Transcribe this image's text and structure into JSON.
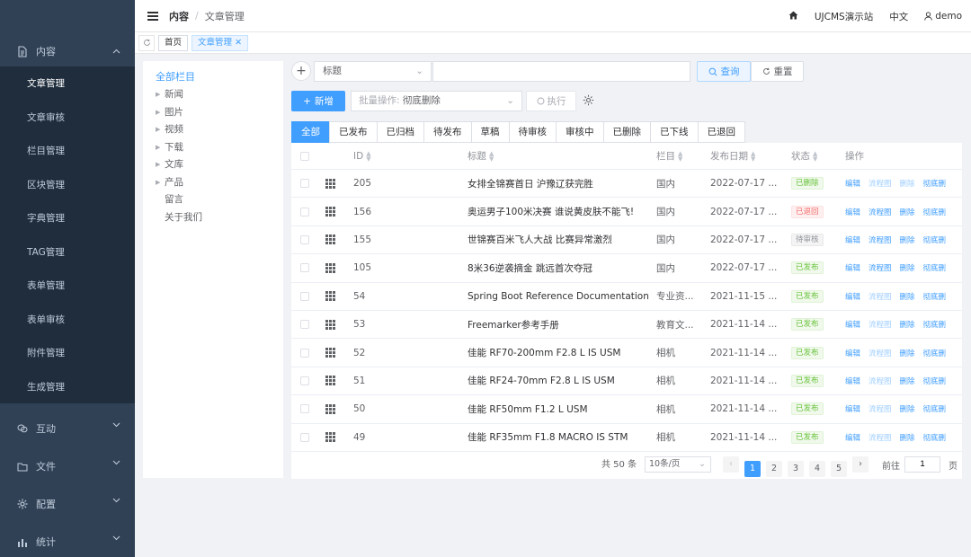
{
  "header": {
    "crumb_main": "内容",
    "crumb_sep": "/",
    "crumb_current": "文章管理",
    "site_name": "UJCMS演示站",
    "language": "中文",
    "user": "demo"
  },
  "tags": {
    "home": "首页",
    "current": "文章管理"
  },
  "sidebar": {
    "group_content": "内容",
    "items": [
      "文章管理",
      "文章审核",
      "栏目管理",
      "区块管理",
      "字典管理",
      "TAG管理",
      "表单管理",
      "表单审核",
      "附件管理",
      "生成管理"
    ],
    "active_index": 0,
    "groups_bottom": [
      "互动",
      "文件",
      "配置",
      "统计"
    ]
  },
  "tree": {
    "root": "全部栏目",
    "nodes": [
      {
        "label": "新闻",
        "has_children": true
      },
      {
        "label": "图片",
        "has_children": true
      },
      {
        "label": "视频",
        "has_children": true
      },
      {
        "label": "下载",
        "has_children": true
      },
      {
        "label": "文库",
        "has_children": true
      },
      {
        "label": "产品",
        "has_children": true
      },
      {
        "label": "留言",
        "has_children": false
      },
      {
        "label": "关于我们",
        "has_children": false
      }
    ]
  },
  "search": {
    "field_selected": "标题",
    "input_value": "",
    "query_label": "查询",
    "reset_label": "重置"
  },
  "actions": {
    "add_label": "新增",
    "batch_prefix": "批量操作:",
    "batch_value": "彻底删除",
    "execute_label": "执行"
  },
  "filters": {
    "tabs": [
      "全部",
      "已发布",
      "已归档",
      "待发布",
      "草稿",
      "待审核",
      "审核中",
      "已删除",
      "已下线",
      "已退回"
    ],
    "active_index": 0
  },
  "table": {
    "columns": {
      "id": "ID",
      "title": "标题",
      "channel": "栏目",
      "date": "发布日期",
      "status": "状态",
      "ops": "操作"
    },
    "op_labels": [
      "编辑",
      "流程图",
      "删除",
      "彻底删"
    ],
    "rows": [
      {
        "id": "205",
        "title": "女排全锦赛首日 沪豫辽获完胜",
        "channel": "国内",
        "date": "2022-07-17 ...",
        "status": "已删除",
        "status_type": "success",
        "ops_enabled": [
          true,
          false,
          false,
          true
        ]
      },
      {
        "id": "156",
        "title": "奥运男子100米决赛 谁说黄皮肤不能飞!",
        "channel": "国内",
        "date": "2022-07-17 ...",
        "status": "已退回",
        "status_type": "danger",
        "ops_enabled": [
          true,
          true,
          true,
          true
        ]
      },
      {
        "id": "155",
        "title": "世锦赛百米飞人大战 比赛异常激烈",
        "channel": "国内",
        "date": "2022-07-17 ...",
        "status": "待审核",
        "status_type": "info",
        "ops_enabled": [
          true,
          true,
          true,
          true
        ]
      },
      {
        "id": "105",
        "title": "8米36逆袭摘金 跳远首次夺冠",
        "channel": "国内",
        "date": "2022-07-17 ...",
        "status": "已发布",
        "status_type": "success",
        "ops_enabled": [
          true,
          true,
          true,
          true
        ]
      },
      {
        "id": "54",
        "title": "Spring Boot Reference Documentation",
        "channel": "专业资...",
        "date": "2021-11-15 ...",
        "status": "已发布",
        "status_type": "success",
        "ops_enabled": [
          true,
          false,
          true,
          true
        ]
      },
      {
        "id": "53",
        "title": "Freemarker参考手册",
        "channel": "教育文...",
        "date": "2021-11-14 ...",
        "status": "已发布",
        "status_type": "success",
        "ops_enabled": [
          true,
          false,
          true,
          true
        ]
      },
      {
        "id": "52",
        "title": "佳能 RF70-200mm F2.8 L IS USM",
        "channel": "相机",
        "date": "2021-11-14 ...",
        "status": "已发布",
        "status_type": "success",
        "ops_enabled": [
          true,
          false,
          true,
          true
        ]
      },
      {
        "id": "51",
        "title": "佳能 RF24-70mm F2.8 L IS USM",
        "channel": "相机",
        "date": "2021-11-14 ...",
        "status": "已发布",
        "status_type": "success",
        "ops_enabled": [
          true,
          false,
          true,
          true
        ]
      },
      {
        "id": "50",
        "title": "佳能 RF50mm F1.2 L USM",
        "channel": "相机",
        "date": "2021-11-14 ...",
        "status": "已发布",
        "status_type": "success",
        "ops_enabled": [
          true,
          false,
          true,
          true
        ]
      },
      {
        "id": "49",
        "title": "佳能 RF35mm F1.8 MACRO IS STM",
        "channel": "相机",
        "date": "2021-11-14 ...",
        "status": "已发布",
        "status_type": "success",
        "ops_enabled": [
          true,
          false,
          true,
          true
        ]
      }
    ]
  },
  "pagination": {
    "total_text": "共 50 条",
    "page_size": "10条/页",
    "pages": [
      "1",
      "2",
      "3",
      "4",
      "5"
    ],
    "current": "1",
    "goto_label": "前往",
    "goto_value": "1",
    "page_unit": "页"
  },
  "colors": {
    "primary": "#409eff",
    "sidebar_bg": "#304156",
    "success": "#67c23a",
    "danger": "#f56c6c",
    "info": "#909399"
  }
}
